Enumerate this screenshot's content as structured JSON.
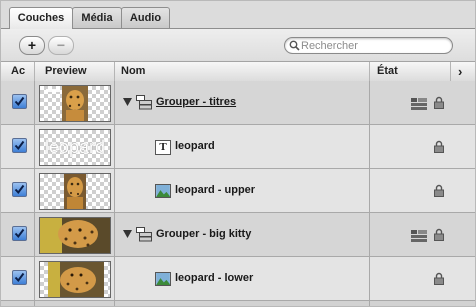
{
  "tabs": [
    {
      "label": "Couches",
      "active": true
    },
    {
      "label": "Média",
      "active": false
    },
    {
      "label": "Audio",
      "active": false
    }
  ],
  "toolbar": {
    "add_label": "+",
    "remove_label": "−",
    "search_placeholder": "Rechercher"
  },
  "columns": {
    "active": "Ac",
    "preview": "Preview",
    "name": "Nom",
    "state": "État",
    "more": "›"
  },
  "rows": [
    {
      "type": "group",
      "name": "Grouper - titres",
      "checked": true,
      "preview": "leopard-image",
      "state_icons": [
        "stack-icon",
        "lock-icon"
      ]
    },
    {
      "type": "text",
      "name": "leopard",
      "preview_text": "leopard",
      "checked": true,
      "state_icons": [
        "lock-icon"
      ]
    },
    {
      "type": "image",
      "name": "leopard - upper",
      "checked": true,
      "preview": "leopard-image",
      "state_icons": [
        "lock-icon"
      ]
    },
    {
      "type": "group",
      "name": "Grouper - big kitty",
      "checked": true,
      "preview": "leopard-image",
      "state_icons": [
        "stack-icon",
        "lock-icon"
      ]
    },
    {
      "type": "image",
      "name": "leopard - lower",
      "checked": true,
      "preview": "leopard-image",
      "state_icons": [
        "lock-icon"
      ]
    }
  ],
  "colors": {
    "checkbox": "#3e7fd6",
    "group_row": "#d6d6d6",
    "item_row": "#e4e4e4"
  }
}
